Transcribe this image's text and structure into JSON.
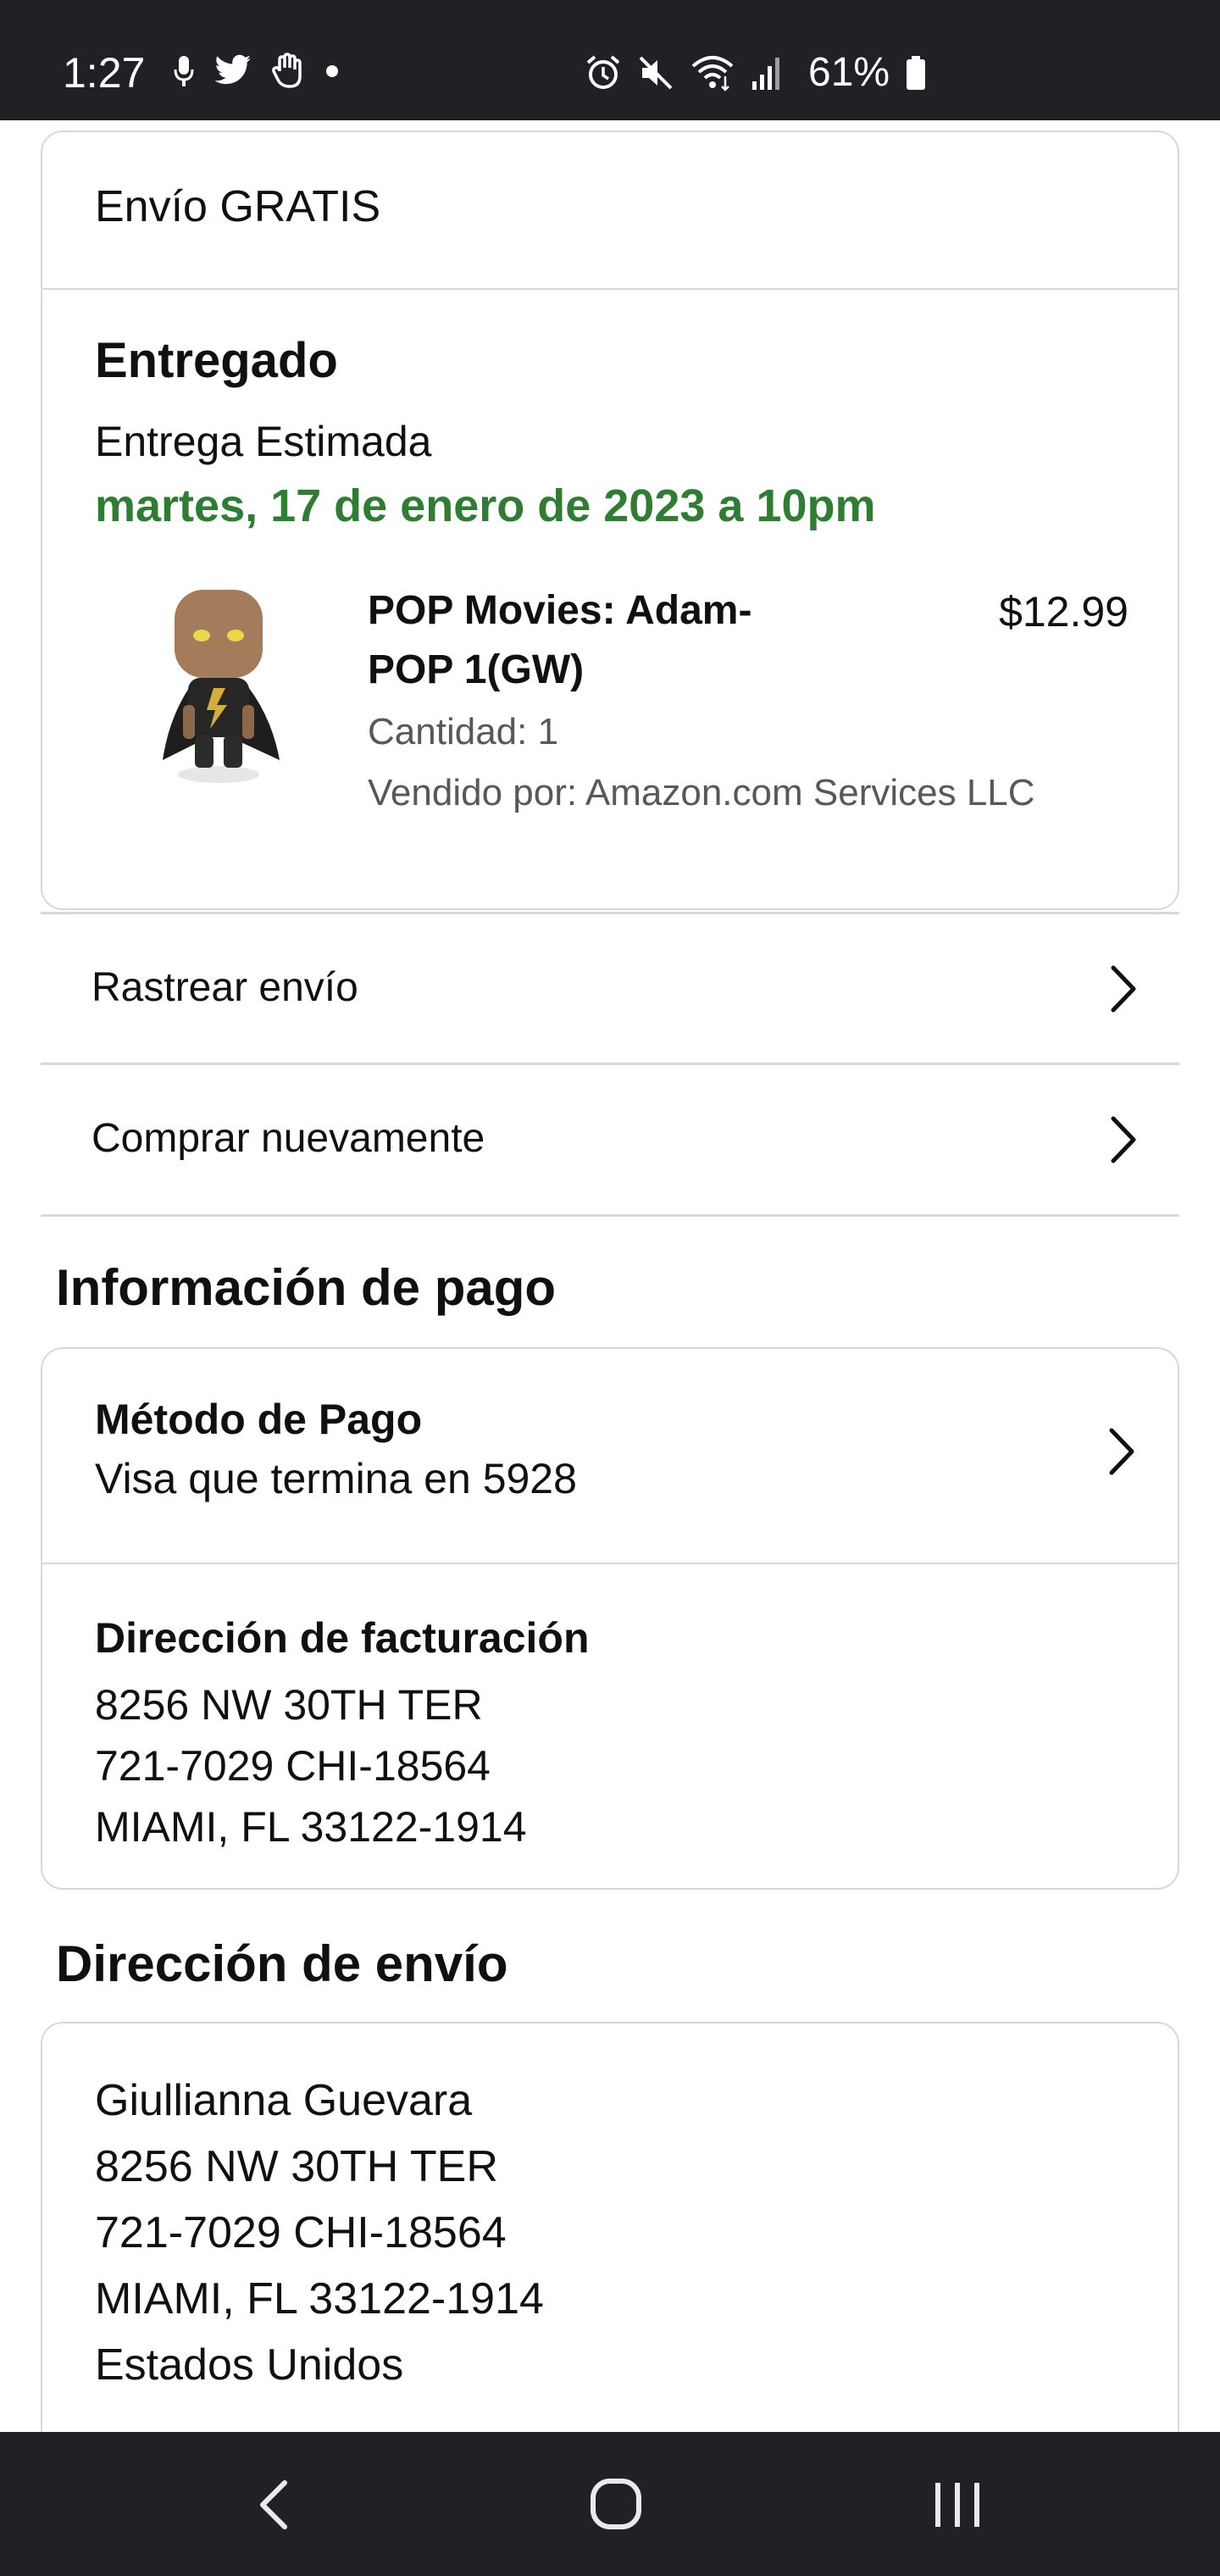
{
  "status_bar": {
    "time": "1:27",
    "battery": "61%",
    "left_icons": [
      "mic-icon",
      "twitter-icon",
      "hand-icon",
      "dot-icon"
    ],
    "right_icons": [
      "alarm-icon",
      "mute-icon",
      "wifi-icon",
      "signal-icon",
      "battery-icon"
    ]
  },
  "shipment": {
    "shipping_label": "Envío GRATIS",
    "status": "Entregado",
    "estimated_label": "Entrega Estimada",
    "delivery_date": "martes, 17 de enero de 2023 a 10pm",
    "item": {
      "title_line1": "POP Movies: Adam-",
      "title_line2": "POP 1(GW)",
      "price": "$12.99",
      "quantity": "Cantidad: 1",
      "seller": "Vendido por: Amazon.com Services LLC",
      "image_icon": "figure-image"
    }
  },
  "actions": {
    "track": "Rastrear envío",
    "buy_again": "Comprar nuevamente"
  },
  "payment": {
    "section_title": "Información de pago",
    "method_label": "Método de Pago",
    "method_value": "Visa que termina en 5928",
    "billing_label": "Dirección de facturación",
    "billing_lines": [
      "8256 NW 30TH TER",
      "721-7029 CHI-18564",
      "MIAMI, FL 33122-1914"
    ]
  },
  "shipping_address": {
    "section_title": "Dirección de envío",
    "lines": [
      "Giullianna Guevara",
      "8256 NW 30TH TER",
      "721-7029 CHI-18564",
      "MIAMI, FL 33122-1914",
      "Estados Unidos"
    ]
  },
  "nav": {
    "icons": [
      "back-icon",
      "home-icon",
      "recents-icon"
    ]
  },
  "colors": {
    "delivery_green": "#2e7d32",
    "border": "#d5d9d9",
    "system_bar": "#202124"
  }
}
